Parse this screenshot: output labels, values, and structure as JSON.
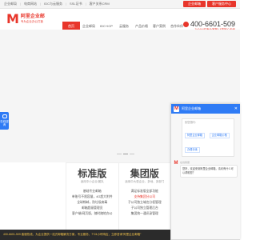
{
  "topbar": {
    "links": [
      "企业邮局",
      "电商网站",
      "IDC与云服务",
      "SSL证书",
      "客户关系CRM"
    ],
    "login_label": "企业邮箱",
    "client_label": "客户服务中心"
  },
  "brand": {
    "mark": "M",
    "name": "阿里企业邮",
    "slogan": "专为企业办公打造"
  },
  "nav": {
    "items": [
      "首页",
      "企业邮局",
      "IDC+ICP",
      "云服务",
      "产品价格",
      "客户案例",
      "合作伙伴"
    ],
    "active_index": 0
  },
  "hotline": {
    "number": "400-6601-509",
    "sub": "7x24小时专业客服 让您放心无忧"
  },
  "hero": {
    "dots": 3,
    "active_dot": 1
  },
  "float_chat": {
    "label": "在线咨询"
  },
  "plans": [
    {
      "name": "标准版",
      "sub": "适用中小企业/团队",
      "features": [
        {
          "text": "基础专业邮箱",
          "red": false
        },
        {
          "text": "单账号不限容量，4G超大附件",
          "red": false
        },
        {
          "text": "全球畅邮，防垃圾病毒",
          "red": false
        },
        {
          "text": "邮箱超级管理员",
          "red": false
        },
        {
          "text": "客户端/网页版，随时随地办公",
          "red": false
        }
      ]
    },
    {
      "name": "集团版",
      "sub": "适用中大型企业，多地、多部门",
      "features": [
        {
          "text": "满足标准版全部功能",
          "red": false
        },
        {
          "text": "支持集团分公司",
          "red": true
        },
        {
          "text": "子公司独立域名分权管理",
          "red": false
        },
        {
          "text": "子公司独立管理后台",
          "red": false
        },
        {
          "text": "集团统一通讯录管理",
          "red": false
        }
      ]
    }
  ],
  "chat": {
    "title": "阿里企业邮箱",
    "close": "✕",
    "time": "—",
    "quick_title": "猜您想问：",
    "quick_options": [
      "阿里企业邮箱",
      "企业邮箱价格",
      "办理手续"
    ],
    "agent_name": "在线客服",
    "message": "您好，欢迎来到阿里企业邮箱，请问有什么可以帮助您？"
  },
  "footer": {
    "text": "400-6601-509 客服热线，为企业提供一站式邮箱解决方案，专业服务，7*24小时响应，立即咨询“阿里企业邮箱”"
  },
  "colors": {
    "brand_red": "#e8362b",
    "chat_blue": "#2f7bf5"
  }
}
